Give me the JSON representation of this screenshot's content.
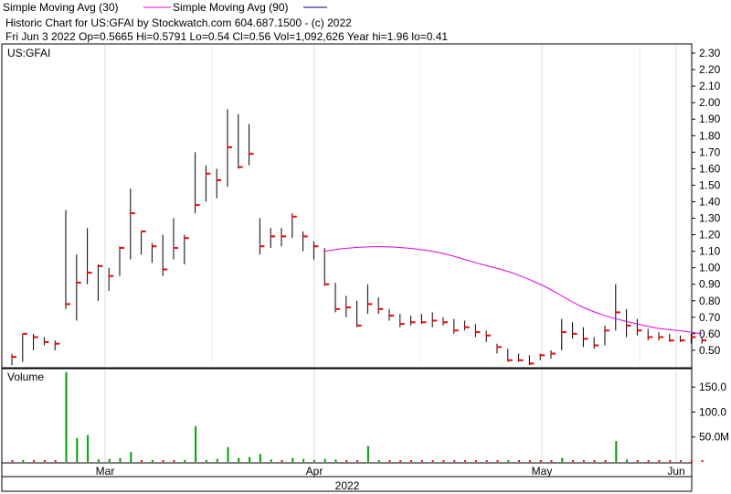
{
  "legend": {
    "sma30": "Simple Moving Avg (30)",
    "sma90": "Simple Moving Avg (90)",
    "sma30_color": "#e000e0",
    "sma90_color": "#000080"
  },
  "header": {
    "line1": "Historic Chart for US:GFAI by Stockwatch.com 604.687.1500 - (c) 2022",
    "line2": "Fri Jun  3 2022  Op=0.5665  Hi=0.5791  Lo=0.54  Cl=0.56  Vol=1,092,626  Year hi=1.96  lo=0.41"
  },
  "chart_data": {
    "type": "ohlc",
    "symbol_label": "US:GFAI",
    "price_axis": {
      "min": 0.4,
      "max": 2.35,
      "ticks": [
        "2.30",
        "2.20",
        "2.10",
        "2.00",
        "1.90",
        "1.80",
        "1.70",
        "1.60",
        "1.50",
        "1.40",
        "1.30",
        "1.20",
        "1.10",
        "1.00",
        "0.90",
        "0.80",
        "0.70",
        "0.60",
        "0.50"
      ]
    },
    "volume_axis": {
      "label": "Volume",
      "max": 185,
      "ticks": [
        "150.0",
        "100.0",
        "50.0"
      ],
      "unit_label": "M"
    },
    "x_labels": [
      "Mar",
      "Apr",
      "May",
      "Jun"
    ],
    "year_label": "2022",
    "bar_color": "#000000",
    "close_color": "#ff0000",
    "volume_color": "#00a000",
    "bars": [
      {
        "h": 0.48,
        "l": 0.41,
        "c": 0.46,
        "v": 2
      },
      {
        "h": 0.6,
        "l": 0.43,
        "c": 0.6,
        "v": 4
      },
      {
        "h": 0.6,
        "l": 0.5,
        "c": 0.58,
        "v": 1
      },
      {
        "h": 0.58,
        "l": 0.53,
        "c": 0.55,
        "v": 1
      },
      {
        "h": 0.56,
        "l": 0.5,
        "c": 0.54,
        "v": 1
      },
      {
        "h": 1.35,
        "l": 0.75,
        "c": 0.78,
        "v": 180
      },
      {
        "h": 1.08,
        "l": 0.68,
        "c": 0.91,
        "v": 48
      },
      {
        "h": 1.24,
        "l": 0.9,
        "c": 0.97,
        "v": 54
      },
      {
        "h": 1.02,
        "l": 0.8,
        "c": 1.01,
        "v": 5
      },
      {
        "h": 1.0,
        "l": 0.86,
        "c": 0.95,
        "v": 6
      },
      {
        "h": 1.13,
        "l": 0.95,
        "c": 1.12,
        "v": 8
      },
      {
        "h": 1.48,
        "l": 1.05,
        "c": 1.33,
        "v": 20
      },
      {
        "h": 1.22,
        "l": 1.08,
        "c": 1.22,
        "v": 3
      },
      {
        "h": 1.15,
        "l": 1.03,
        "c": 1.13,
        "v": 4
      },
      {
        "h": 1.2,
        "l": 0.95,
        "c": 0.99,
        "v": 3
      },
      {
        "h": 1.3,
        "l": 1.05,
        "c": 1.12,
        "v": 3
      },
      {
        "h": 1.2,
        "l": 1.02,
        "c": 1.18,
        "v": 4
      },
      {
        "h": 1.7,
        "l": 1.33,
        "c": 1.38,
        "v": 72
      },
      {
        "h": 1.62,
        "l": 1.4,
        "c": 1.57,
        "v": 4
      },
      {
        "h": 1.6,
        "l": 1.42,
        "c": 1.53,
        "v": 6
      },
      {
        "h": 1.96,
        "l": 1.49,
        "c": 1.73,
        "v": 30
      },
      {
        "h": 1.93,
        "l": 1.6,
        "c": 1.61,
        "v": 8
      },
      {
        "h": 1.87,
        "l": 1.62,
        "c": 1.69,
        "v": 10
      },
      {
        "h": 1.3,
        "l": 1.08,
        "c": 1.13,
        "v": 16
      },
      {
        "h": 1.24,
        "l": 1.12,
        "c": 1.19,
        "v": 5
      },
      {
        "h": 1.24,
        "l": 1.13,
        "c": 1.19,
        "v": 3
      },
      {
        "h": 1.33,
        "l": 1.18,
        "c": 1.31,
        "v": 8
      },
      {
        "h": 1.22,
        "l": 1.1,
        "c": 1.19,
        "v": 6
      },
      {
        "h": 1.16,
        "l": 1.05,
        "c": 1.13,
        "v": 4
      },
      {
        "h": 1.12,
        "l": 0.89,
        "c": 0.9,
        "v": 6
      },
      {
        "h": 0.91,
        "l": 0.73,
        "c": 0.75,
        "v": 5
      },
      {
        "h": 0.83,
        "l": 0.7,
        "c": 0.76,
        "v": 3
      },
      {
        "h": 0.8,
        "l": 0.64,
        "c": 0.65,
        "v": 3
      },
      {
        "h": 0.9,
        "l": 0.72,
        "c": 0.78,
        "v": 32
      },
      {
        "h": 0.82,
        "l": 0.72,
        "c": 0.75,
        "v": 4
      },
      {
        "h": 0.75,
        "l": 0.68,
        "c": 0.71,
        "v": 3
      },
      {
        "h": 0.72,
        "l": 0.64,
        "c": 0.66,
        "v": 3
      },
      {
        "h": 0.71,
        "l": 0.65,
        "c": 0.67,
        "v": 2
      },
      {
        "h": 0.72,
        "l": 0.66,
        "c": 0.67,
        "v": 3
      },
      {
        "h": 0.73,
        "l": 0.64,
        "c": 0.68,
        "v": 2
      },
      {
        "h": 0.7,
        "l": 0.65,
        "c": 0.67,
        "v": 2
      },
      {
        "h": 0.69,
        "l": 0.6,
        "c": 0.62,
        "v": 2
      },
      {
        "h": 0.68,
        "l": 0.62,
        "c": 0.64,
        "v": 2
      },
      {
        "h": 0.66,
        "l": 0.58,
        "c": 0.61,
        "v": 2
      },
      {
        "h": 0.62,
        "l": 0.55,
        "c": 0.59,
        "v": 2
      },
      {
        "h": 0.54,
        "l": 0.48,
        "c": 0.52,
        "v": 3
      },
      {
        "h": 0.51,
        "l": 0.43,
        "c": 0.44,
        "v": 4
      },
      {
        "h": 0.48,
        "l": 0.43,
        "c": 0.44,
        "v": 2
      },
      {
        "h": 0.47,
        "l": 0.41,
        "c": 0.42,
        "v": 2
      },
      {
        "h": 0.48,
        "l": 0.44,
        "c": 0.47,
        "v": 2
      },
      {
        "h": 0.5,
        "l": 0.45,
        "c": 0.48,
        "v": 2
      },
      {
        "h": 0.69,
        "l": 0.5,
        "c": 0.61,
        "v": 8
      },
      {
        "h": 0.67,
        "l": 0.57,
        "c": 0.6,
        "v": 3
      },
      {
        "h": 0.64,
        "l": 0.52,
        "c": 0.57,
        "v": 3
      },
      {
        "h": 0.58,
        "l": 0.51,
        "c": 0.53,
        "v": 2
      },
      {
        "h": 0.65,
        "l": 0.53,
        "c": 0.62,
        "v": 3
      },
      {
        "h": 0.9,
        "l": 0.62,
        "c": 0.73,
        "v": 42
      },
      {
        "h": 0.75,
        "l": 0.58,
        "c": 0.65,
        "v": 5
      },
      {
        "h": 0.69,
        "l": 0.59,
        "c": 0.62,
        "v": 3
      },
      {
        "h": 0.63,
        "l": 0.56,
        "c": 0.58,
        "v": 3
      },
      {
        "h": 0.61,
        "l": 0.56,
        "c": 0.58,
        "v": 2
      },
      {
        "h": 0.6,
        "l": 0.55,
        "c": 0.56,
        "v": 2
      },
      {
        "h": 0.59,
        "l": 0.55,
        "c": 0.56,
        "v": 2
      },
      {
        "h": 0.6,
        "l": 0.54,
        "c": 0.58,
        "v": 2
      },
      {
        "h": 0.58,
        "l": 0.54,
        "c": 0.56,
        "v": 2
      }
    ],
    "sma30": [
      {
        "i": 29,
        "y": 1.1
      },
      {
        "i": 31,
        "y": 1.12
      },
      {
        "i": 34,
        "y": 1.13
      },
      {
        "i": 37,
        "y": 1.12
      },
      {
        "i": 40,
        "y": 1.09
      },
      {
        "i": 43,
        "y": 1.03
      },
      {
        "i": 46,
        "y": 0.98
      },
      {
        "i": 48,
        "y": 0.93
      },
      {
        "i": 50,
        "y": 0.87
      },
      {
        "i": 52,
        "y": 0.79
      },
      {
        "i": 54,
        "y": 0.73
      },
      {
        "i": 56,
        "y": 0.69
      },
      {
        "i": 58,
        "y": 0.66
      },
      {
        "i": 60,
        "y": 0.63
      },
      {
        "i": 62,
        "y": 0.62
      },
      {
        "i": 64,
        "y": 0.6
      }
    ]
  }
}
